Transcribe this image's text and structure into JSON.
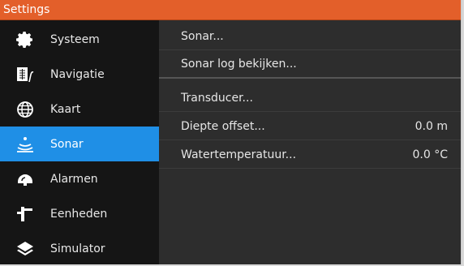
{
  "window": {
    "title": "Settings"
  },
  "sidebar": {
    "items": [
      {
        "label": "Systeem",
        "icon": "gear-icon"
      },
      {
        "label": "Navigatie",
        "icon": "navigation-icon"
      },
      {
        "label": "Kaart",
        "icon": "globe-icon"
      },
      {
        "label": "Sonar",
        "icon": "sonar-icon",
        "active": true
      },
      {
        "label": "Alarmen",
        "icon": "alarm-icon"
      },
      {
        "label": "Eenheden",
        "icon": "units-icon"
      },
      {
        "label": "Simulator",
        "icon": "layers-icon"
      }
    ]
  },
  "content": {
    "rows": [
      {
        "label": "Sonar...",
        "value": ""
      },
      {
        "label": "Sonar log bekijken...",
        "value": ""
      },
      {
        "label": "Transducer...",
        "value": ""
      },
      {
        "label": "Diepte offset...",
        "value": "0.0 m"
      },
      {
        "label": "Watertemperatuur...",
        "value": "0.0 °C"
      }
    ]
  },
  "colors": {
    "titlebar": "#e35f2a",
    "active": "#1f8fe6"
  }
}
